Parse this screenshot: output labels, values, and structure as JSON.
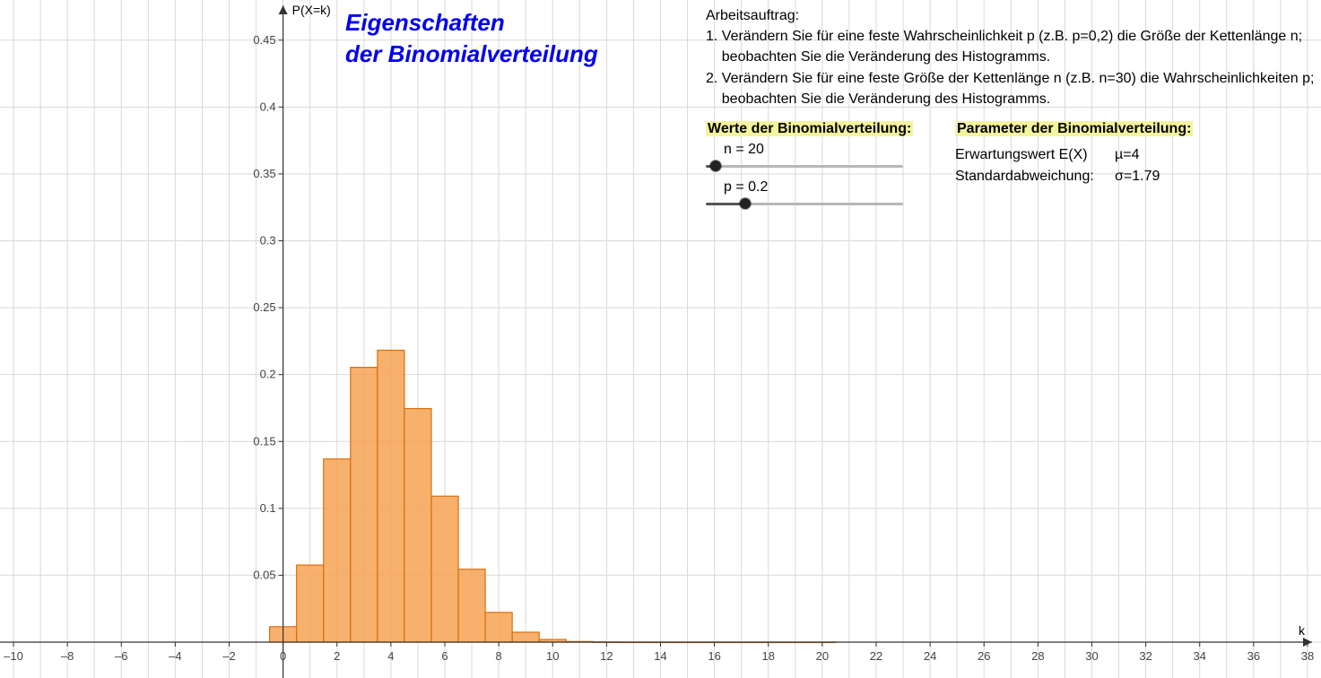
{
  "title_line1": "Eigenschaften",
  "title_line2": "der Binomialverteilung",
  "assignment": {
    "header": "Arbeitsauftrag:",
    "item1a": "1. Verändern Sie für eine feste Wahrscheinlichkeit p (z.B. p=0,2) die Größe der Kettenlänge n;",
    "item1b": "    beobachten Sie die Veränderung des Histogramms.",
    "item2a": "2. Verändern Sie für eine feste Größe der Kettenlänge n (z.B. n=30) die Wahrscheinlichkeiten p;",
    "item2b": "    beobachten Sie die Veränderung des Histogramms."
  },
  "values_section_label": "Werte der Binomialverteilung:",
  "params_section_label": "Parameter der Binomialverteilung:",
  "sliders": {
    "n": {
      "label": "n = 20",
      "value": 20,
      "min": 0,
      "max": 100,
      "frac": 0.05
    },
    "p": {
      "label": "p = 0.2",
      "value": 0.2,
      "min": 0,
      "max": 1,
      "frac": 0.2
    }
  },
  "params": {
    "ev_label": "Erwartungswert E(X)",
    "ev_value": "µ=4",
    "sd_label": "Standardabweichung:",
    "sd_value": "σ=1.79"
  },
  "chart_data": {
    "type": "bar",
    "title": "",
    "xlabel": "k",
    "ylabel": "P(X=k)",
    "xlim": [
      -10,
      38
    ],
    "ylim": [
      0,
      0.45
    ],
    "x_ticks": [
      -10,
      -8,
      -6,
      -4,
      -2,
      0,
      2,
      4,
      6,
      8,
      10,
      12,
      14,
      16,
      18,
      20,
      22,
      24,
      26,
      28,
      30,
      32,
      34,
      36,
      38
    ],
    "y_ticks": [
      0.05,
      0.1,
      0.15,
      0.2,
      0.25,
      0.3,
      0.35,
      0.4,
      0.45
    ],
    "categories": [
      0,
      1,
      2,
      3,
      4,
      5,
      6,
      7,
      8,
      9,
      10,
      11,
      12,
      13,
      14,
      15,
      16,
      17,
      18,
      19,
      20
    ],
    "values": [
      0.0115,
      0.0576,
      0.1369,
      0.2054,
      0.2182,
      0.1746,
      0.1091,
      0.0545,
      0.0222,
      0.0074,
      0.002,
      0.00046,
      8.6e-05,
      1.33e-05,
      1.7e-06,
      1.7e-07,
      1.3e-08,
      7.7e-10,
      3.2e-11,
      8.4e-13,
      1e-14
    ]
  },
  "colors": {
    "grid": "#d9d9d9",
    "axis": "#333333",
    "bar_fill": "#f7a254",
    "bar_stroke": "#d96f0f",
    "title": "#0000ee",
    "highlight": "#f3f3a0"
  }
}
